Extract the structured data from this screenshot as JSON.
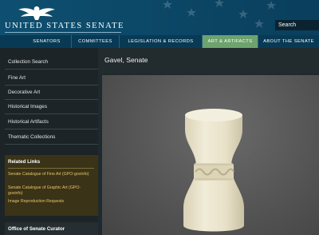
{
  "header": {
    "logo_text": "UNITED STATES SENATE",
    "search_placeholder": "Search"
  },
  "nav": {
    "items": [
      {
        "label": "SENATORS",
        "active": false
      },
      {
        "label": "COMMITTEES",
        "active": false
      },
      {
        "label": "LEGISLATION & RECORDS",
        "active": false
      },
      {
        "label": "ART & ARTIFACTS",
        "active": true
      },
      {
        "label": "ABOUT THE SENATE",
        "active": false
      }
    ],
    "active_color": "#6da36d"
  },
  "sidebar": {
    "items": [
      {
        "label": "Collection Search"
      },
      {
        "label": "Fine Art"
      },
      {
        "label": "Decorative Art"
      },
      {
        "label": "Historical Images"
      },
      {
        "label": "Historical Artifacts"
      },
      {
        "label": "Thematic Collections"
      }
    ],
    "related_links": {
      "title": "Related Links",
      "links": [
        "Senate Catalogue of Fine Art (GPO-govinfo)",
        "Senate Catalogue of Graphic Art (GPO-govinfo)",
        "Image Reproduction Requests"
      ],
      "link_color": "#e8c66a"
    },
    "curator_heading": "Office of Senate Curator"
  },
  "main": {
    "title": "Gavel, Senate",
    "image_icon": "ivory-gavel-image"
  }
}
